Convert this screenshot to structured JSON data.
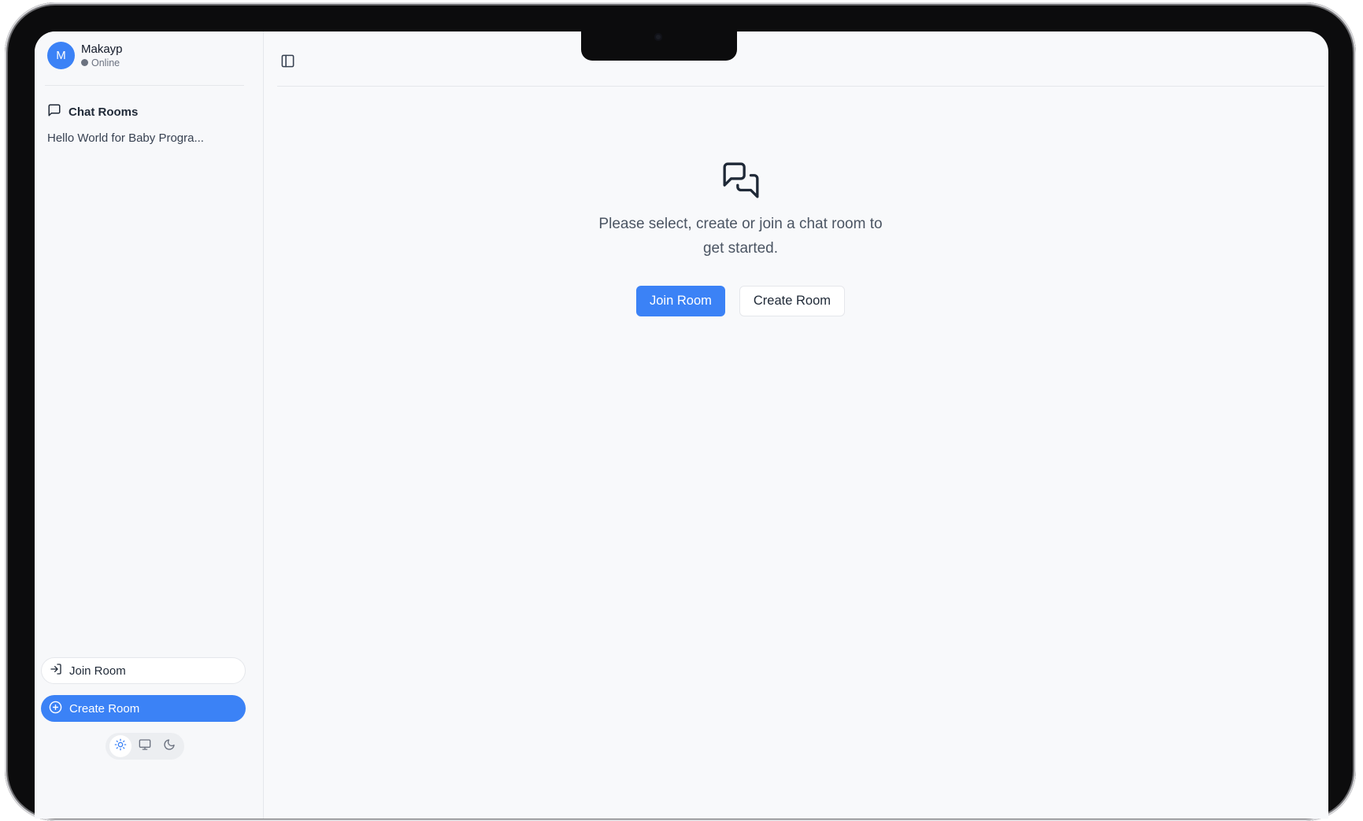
{
  "user": {
    "initial": "M",
    "name": "Makayp",
    "status": "Online"
  },
  "sidebar": {
    "section_title": "Chat Rooms",
    "rooms": [
      "Hello World for Baby Progra..."
    ],
    "join_label": "Join Room",
    "create_label": "Create Room",
    "theme_options": [
      "light-theme",
      "system-theme",
      "dark-theme"
    ],
    "active_theme": "light-theme"
  },
  "main": {
    "empty_message": "Please select, create or join a chat room to get started.",
    "join_label": "Join Room",
    "create_label": "Create Room"
  },
  "colors": {
    "accent": "#3b82f6",
    "background": "#f8f9fb",
    "sidebar_bg": "#f7f8fa",
    "border": "#e5e7eb"
  }
}
